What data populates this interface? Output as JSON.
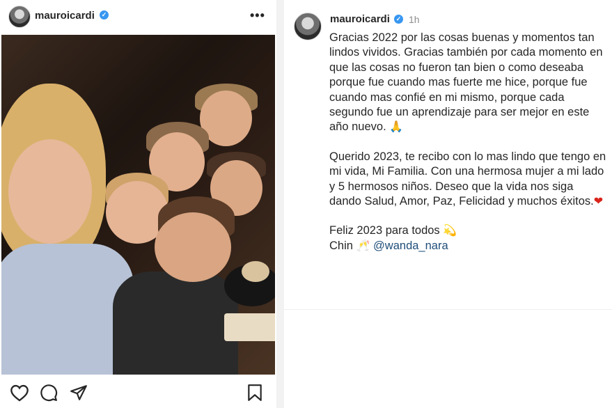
{
  "post": {
    "username": "mauroicardi",
    "verified_mark": "✓",
    "more_label": "•••",
    "photo_alt": "",
    "actions": [
      "heart-icon",
      "comment-icon",
      "share-icon",
      "save-icon"
    ]
  },
  "caption_panel": {
    "username": "mauroicardi",
    "verified_mark": "✓",
    "time": "1h",
    "para1": "Gracias 2022 por las cosas buenas y momentos tan lindos vividos. Gracias también por cada momento en que las cosas no fueron tan bien o como deseaba porque fue cuando mas fuerte me hice, porque fue cuando mas confié en mi mismo, porque cada segundo fue un aprendizaje para ser mejor en este año nuevo.",
    "para1_emoji": "🙏",
    "para2": "Querido 2023, te recibo con lo mas lindo que tengo en mi vida, Mi Familia. Con una hermosa mujer a mi lado y 5 hermosos niños. Deseo que la vida nos siga dando Salud, Amor, Paz, Felicidad y muchos éxitos.",
    "para2_emoji": "❤",
    "line3": "Feliz 2023 para todos",
    "line3_emoji": "💫",
    "line4_prefix": "Chin",
    "line4_emoji": "🥂",
    "mention": "@wanda_nara"
  },
  "colors": {
    "verified": "#3897f0",
    "secondary_text": "#8e8e8e",
    "mention": "#1f4e79",
    "heart": "#d9241b"
  }
}
